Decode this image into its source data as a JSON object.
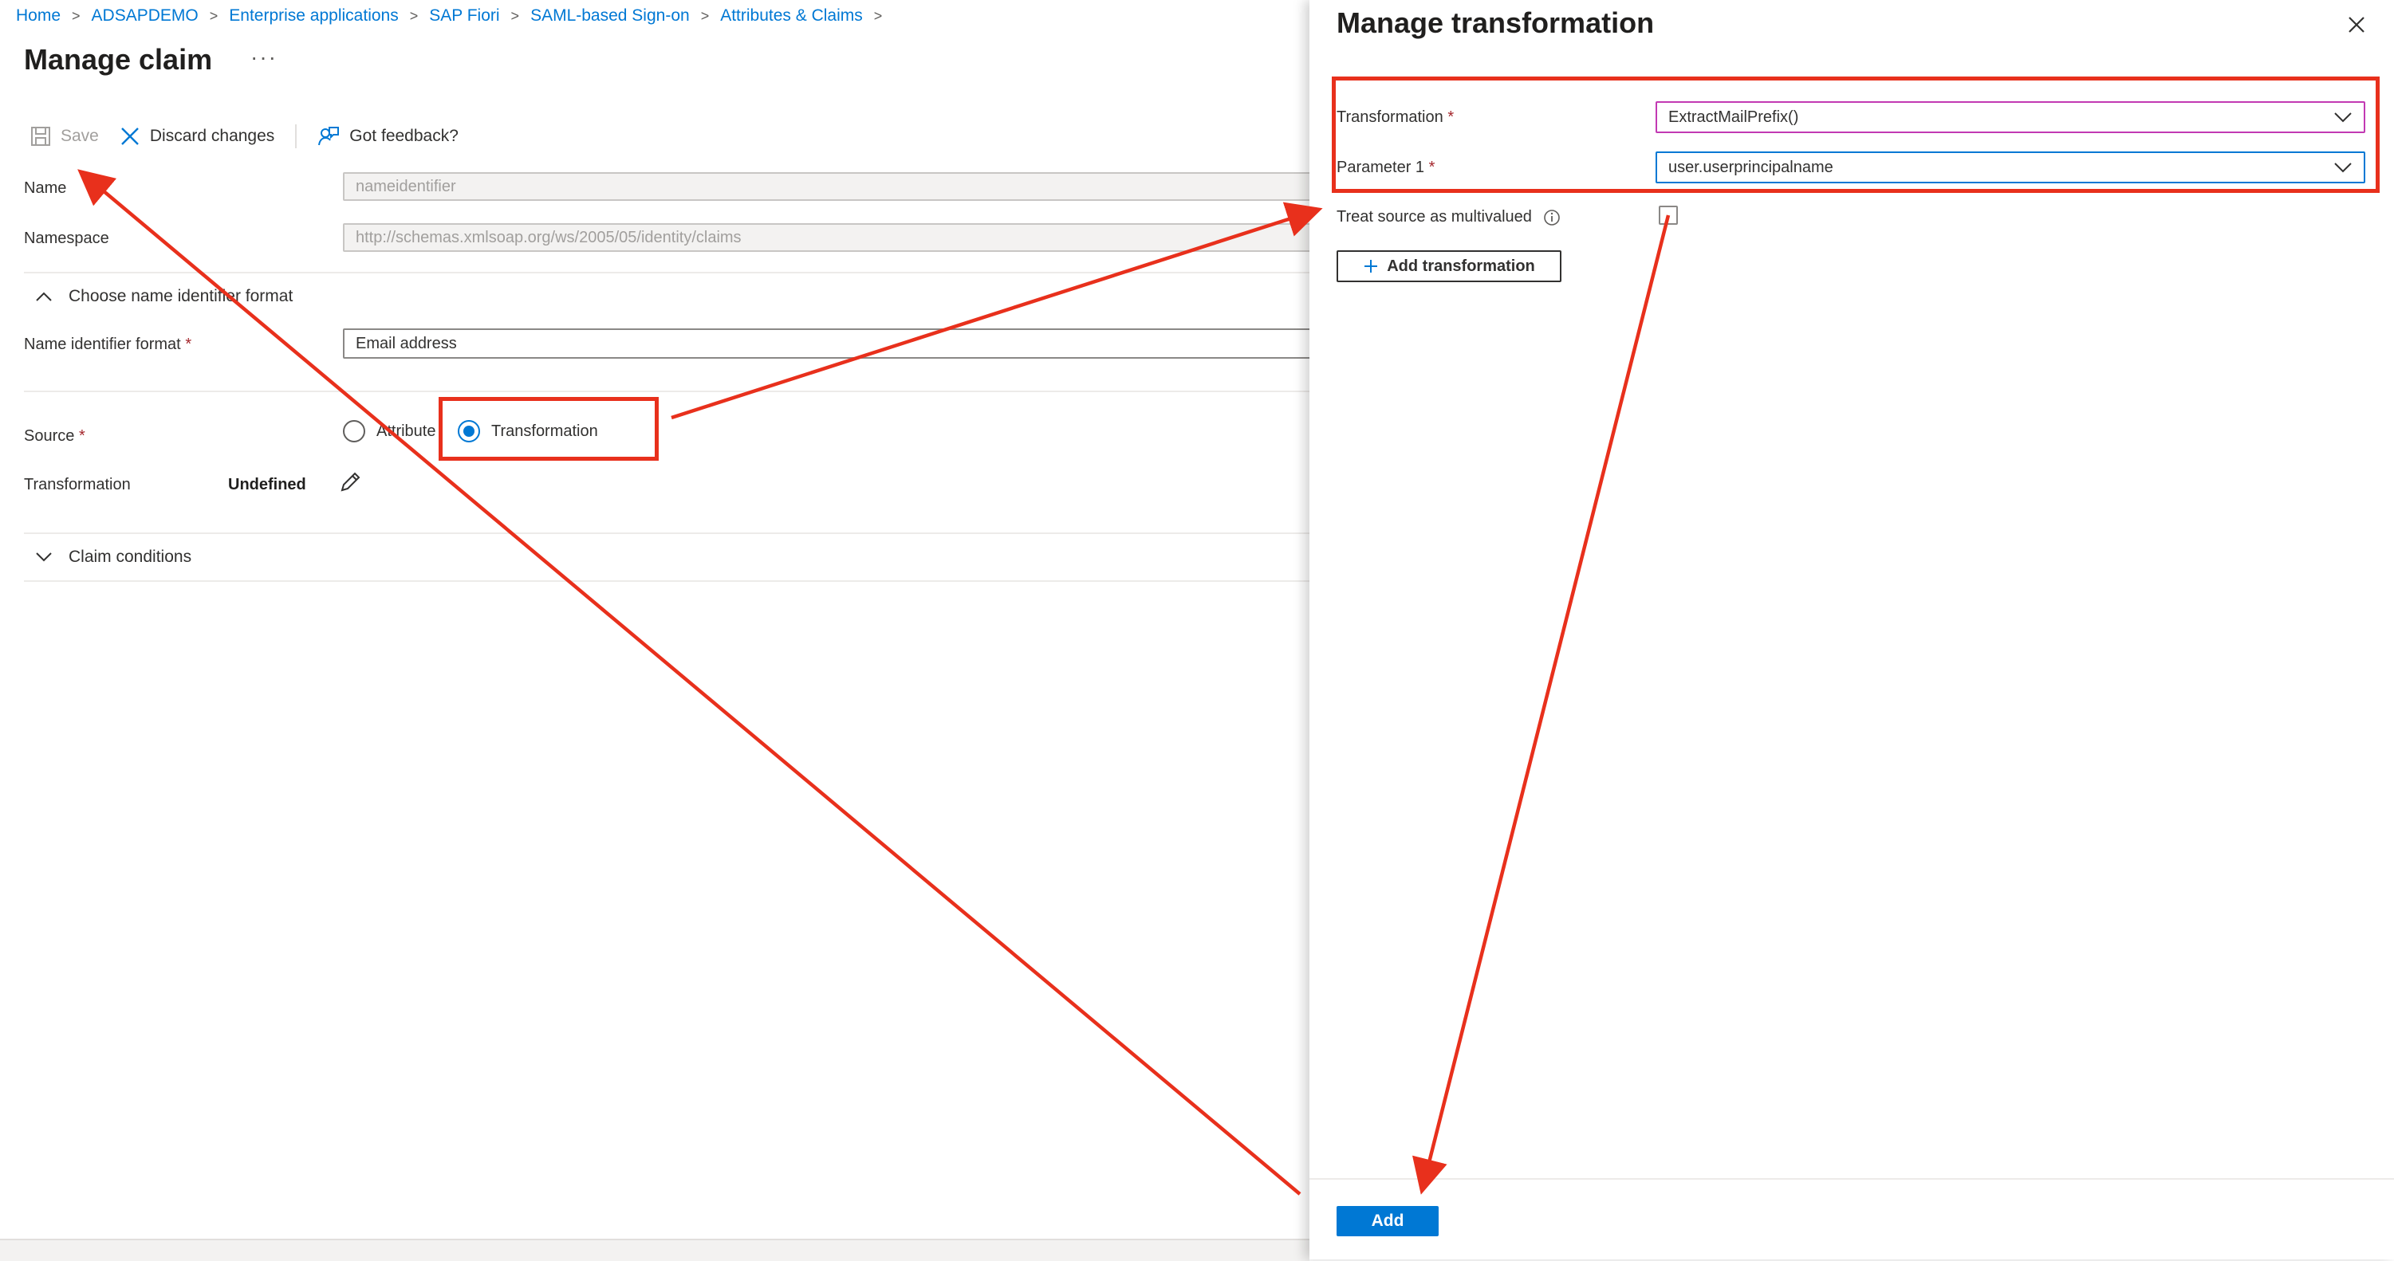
{
  "breadcrumb": {
    "items": [
      "Home",
      "ADSAPDEMO",
      "Enterprise applications",
      "SAP Fiori",
      "SAML-based Sign-on",
      "Attributes & Claims"
    ],
    "separator": ">"
  },
  "page": {
    "title": "Manage claim",
    "more_label": "···"
  },
  "toolbar": {
    "save_label": "Save",
    "discard_label": "Discard changes",
    "feedback_label": "Got feedback?"
  },
  "form": {
    "name_label": "Name",
    "name_value": "nameidentifier",
    "namespace_label": "Namespace",
    "namespace_value": "http://schemas.xmlsoap.org/ws/2005/05/identity/claims",
    "section_name_id_format": "Choose name identifier format",
    "name_id_format_label": "Name identifier format",
    "name_id_format_value": "Email address",
    "source_label": "Source",
    "source_option_attribute": "Attribute",
    "source_option_transformation": "Transformation",
    "source_selected": "Transformation",
    "transformation_label": "Transformation",
    "transformation_value": "Undefined",
    "section_claim_conditions": "Claim conditions",
    "required_mark": "*"
  },
  "panel": {
    "title": "Manage transformation",
    "transformation_label": "Transformation",
    "transformation_value": "ExtractMailPrefix()",
    "parameter1_label": "Parameter 1",
    "parameter1_value": "user.userprincipalname",
    "multivalued_label": "Treat source as multivalued",
    "multivalued_checked": false,
    "add_transformation_label": "Add transformation",
    "add_label": "Add"
  },
  "colors": {
    "accent": "#0078d4",
    "annotation_red": "#e8301c",
    "required_red": "#a4262c"
  }
}
